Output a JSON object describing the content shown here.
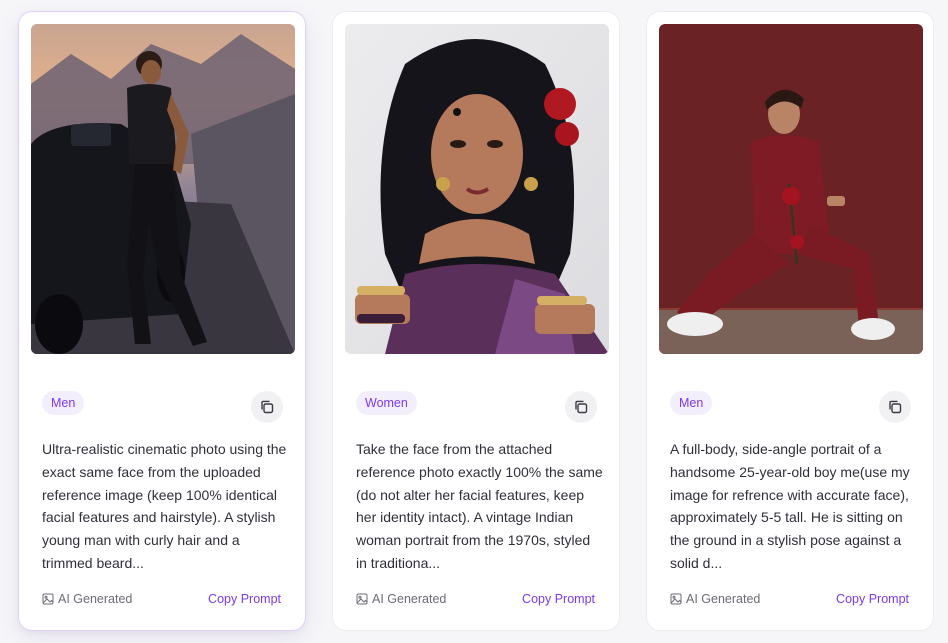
{
  "cards": [
    {
      "tag": "Men",
      "description": "Ultra-realistic cinematic photo using the exact same face from the uploaded reference image (keep 100% identical facial features and hairstyle). A stylish young man with curly hair and a trimmed beard...",
      "badge": "AI Generated",
      "copy_label": "Copy Prompt"
    },
    {
      "tag": "Women",
      "description": "Take the face from the attached reference photo exactly 100% the same (do not alter her facial features, keep her identity intact). A vintage Indian woman portrait from the 1970s, styled in traditiona...",
      "badge": "AI Generated",
      "copy_label": "Copy Prompt"
    },
    {
      "tag": "Men",
      "description": "A full-body, side-angle portrait of a handsome 25-year-old boy me(use my image for refrence with accurate face), approximately 5-5 tall. He is sitting on the ground in a stylish pose against a solid d...",
      "badge": "AI Generated",
      "copy_label": "Copy Prompt"
    }
  ],
  "icons": {
    "copy": "copy-icon",
    "image": "image-icon"
  },
  "colors": {
    "accent": "#7c3aed",
    "tag_bg": "#f3eefc",
    "text": "#2f2f3a",
    "muted": "#6b6b76"
  }
}
